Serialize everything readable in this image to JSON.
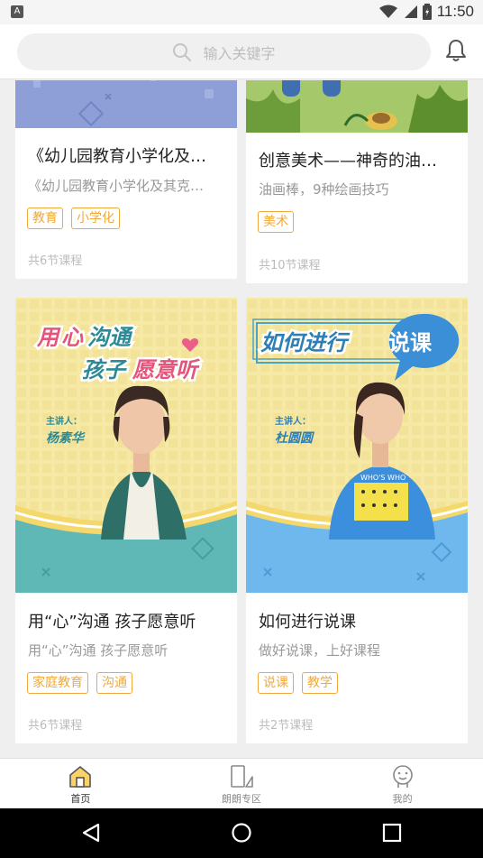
{
  "status_bar": {
    "time": "11:50",
    "app_badge": "A"
  },
  "header": {
    "search_placeholder": "输入关键字"
  },
  "cards": [
    {
      "title": "《幼儿园教育小学化及…",
      "subtitle": "《幼儿园教育小学化及其克…",
      "tags": [
        "教育",
        "小学化"
      ],
      "meta": "共6节课程"
    },
    {
      "title": "创意美术——神奇的油…",
      "subtitle": "油画棒，9种绘画技巧",
      "tags": [
        "美术"
      ],
      "meta": "共10节课程"
    },
    {
      "title": "用“心”沟通 孩子愿意听",
      "subtitle": "用“心”沟通 孩子愿意听",
      "tags": [
        "家庭教育",
        "沟通"
      ],
      "meta": "共6节课程",
      "poster": {
        "line1_a": "用",
        "line1_b": "心",
        "line1_c": "沟通",
        "line2_a": "孩子",
        "line2_b": "愿意听",
        "speaker_label": "主讲人：",
        "speaker_name": "杨素华"
      }
    },
    {
      "title": "如何进行说课",
      "subtitle": "做好说课，上好课程",
      "tags": [
        "说课",
        "教学"
      ],
      "meta": "共2节课程",
      "poster": {
        "headline": "如何进行",
        "bubble": "说课",
        "speaker_label": "主讲人：",
        "speaker_name": "杜圆圆",
        "shirt_text": "WHO'S WHO"
      }
    }
  ],
  "bottom_nav": [
    {
      "label": "首页",
      "icon": "home-icon",
      "active": true
    },
    {
      "label": "朗朗专区",
      "icon": "tablet-pen-icon",
      "active": false
    },
    {
      "label": "我的",
      "icon": "profile-face-icon",
      "active": false
    }
  ],
  "colors": {
    "accent": "#f0a93a",
    "tag_border": "#f0a93a",
    "poster_yellow": "#f6e9a6",
    "poster_teal": "#5fb7b6",
    "poster_blue": "#6fb8ee"
  }
}
